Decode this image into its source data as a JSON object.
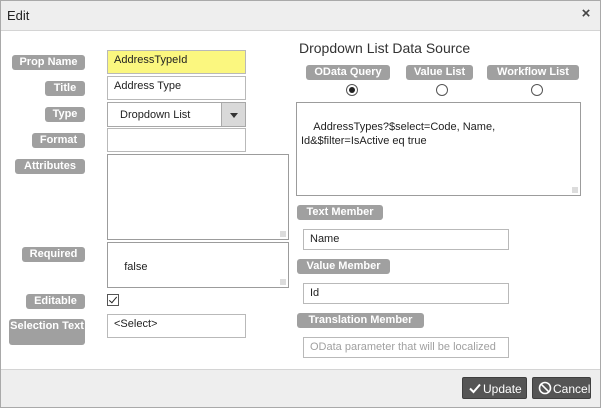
{
  "dialog": {
    "title": "Edit",
    "close_symbol": "×",
    "icons": {
      "close": "close-icon",
      "check": "check-icon",
      "cancel": "cancel-icon"
    }
  },
  "left": {
    "prop_name": {
      "label": "Prop Name",
      "value": "AddressTypeId"
    },
    "title": {
      "label": "Title",
      "value": "Address Type"
    },
    "type": {
      "label": "Type",
      "value": "Dropdown List"
    },
    "format": {
      "label": "Format",
      "value": ""
    },
    "attributes": {
      "label": "Attributes",
      "value": ""
    },
    "required": {
      "label": "Required",
      "value": "false"
    },
    "editable": {
      "label": "Editable",
      "checked": true
    },
    "selection_text": {
      "label": "Selection Text",
      "value": "<Select>"
    }
  },
  "datasource": {
    "heading": "Dropdown List Data Source",
    "options": [
      {
        "label": "OData Query",
        "selected": true
      },
      {
        "label": "Value List",
        "selected": false
      },
      {
        "label": "Workflow List",
        "selected": false
      }
    ],
    "query": "AddressTypes?$select=Code, Name, Id&$filter=IsActive eq true",
    "text_member": {
      "label": "Text Member",
      "value": "Name"
    },
    "value_member": {
      "label": "Value Member",
      "value": "Id"
    },
    "translation_member": {
      "label": "Translation Member",
      "placeholder": "OData parameter that will be localized"
    }
  },
  "footer": {
    "update_label": "Update",
    "cancel_label": "Cancel"
  }
}
